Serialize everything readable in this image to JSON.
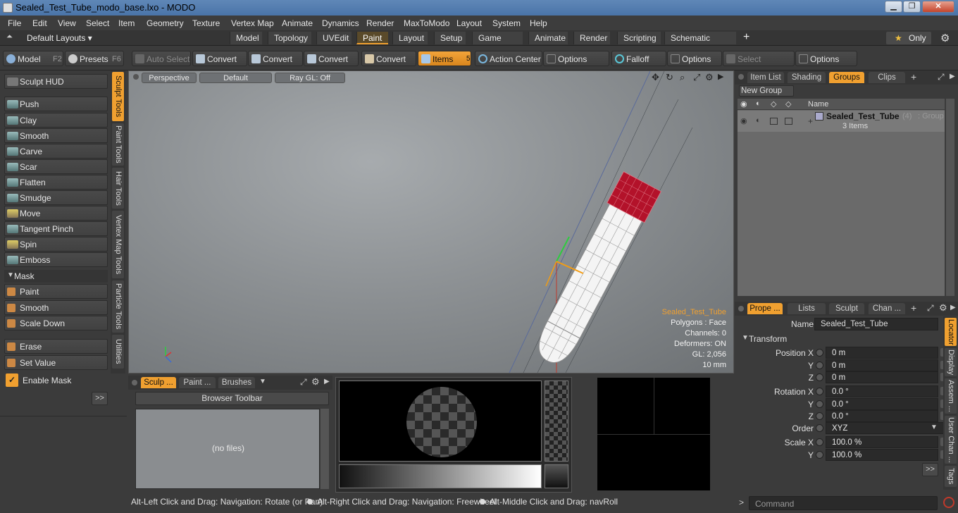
{
  "window": {
    "title": "Sealed_Test_Tube_modo_base.lxo - MODO",
    "controls": [
      "▁",
      "❐",
      "✕"
    ]
  },
  "menu": [
    "File",
    "Edit",
    "View",
    "Select",
    "Item",
    "Geometry",
    "Texture",
    "Vertex Map",
    "Animate",
    "Dynamics",
    "Render",
    "MaxToModo",
    "Layout",
    "System",
    "Help"
  ],
  "layouts": {
    "dropdown": "Default Layouts ▾",
    "tabs": [
      "Model",
      "Topology",
      "UVEdit",
      "Paint",
      "Layout",
      "Setup",
      "Game Tools",
      "Animate",
      "Render",
      "Scripting",
      "Schematic Fusion"
    ],
    "add": "+",
    "only": "Only",
    "star": "★"
  },
  "toolbar": {
    "model": "Model",
    "model_key": "F2",
    "presets": "Presets",
    "presets_key": "F6",
    "auto_select": "Auto Select",
    "convert": "Convert",
    "items": "Items",
    "items_key": "5",
    "action_center": "Action Center",
    "options": "Options",
    "falloff": "Falloff",
    "select_through": "Select Through"
  },
  "left": {
    "sculpt_hud": "Sculpt HUD",
    "tools": [
      "Push",
      "Clay",
      "Smooth",
      "Carve",
      "Scar",
      "Flatten",
      "Smudge",
      "Move",
      "Tangent Pinch",
      "Spin",
      "Emboss"
    ],
    "mask_header": "Mask",
    "mask_tools": [
      "Paint",
      "Smooth",
      "Scale Down"
    ],
    "erase": "Erase",
    "set_value": "Set Value",
    "enable_mask": "Enable Mask",
    "more": ">>"
  },
  "vtabs": [
    "Sculpt Tools",
    "Paint Tools",
    "Hair Tools",
    "Vertex Map Tools",
    "Particle Tools",
    "Utilities"
  ],
  "viewport": {
    "perspective": "Perspective",
    "default": "Default",
    "raygl": "Ray GL: Off",
    "info": {
      "name": "Sealed_Test_Tube",
      "polygons": "Polygons : Face",
      "channels": "Channels: 0",
      "deformers": "Deformers: ON",
      "gl": "GL: 2,056",
      "size": "10 mm"
    }
  },
  "right_top": {
    "tabs": [
      "Item List",
      "Shading",
      "Groups",
      "Clips"
    ],
    "new_group": "New Group",
    "name_col": "Name",
    "group_name": "Sealed_Test_Tube",
    "group_count": "(4)",
    "group_type": ": Group",
    "group_items": "3 Items"
  },
  "properties": {
    "tabs": [
      "Prope ...",
      "Lists",
      "Sculpt",
      "Chan ..."
    ],
    "name_label": "Name",
    "name_value": "Sealed_Test_Tube",
    "transform": "Transform",
    "rows": [
      {
        "label": "Position X",
        "value": "0 m"
      },
      {
        "label": "Y",
        "value": "0 m"
      },
      {
        "label": "Z",
        "value": "0 m"
      },
      {
        "label": "Rotation X",
        "value": "0.0 °"
      },
      {
        "label": "Y",
        "value": "0.0 °"
      },
      {
        "label": "Z",
        "value": "0.0 °"
      },
      {
        "label": "Order",
        "value": "XYZ"
      },
      {
        "label": "Scale X",
        "value": "100.0 %"
      },
      {
        "label": "Y",
        "value": "100.0 %"
      }
    ],
    "side_tabs": [
      "Locator",
      "Display",
      "Assem ...",
      "User Chan ...",
      "Tags"
    ],
    "more": ">>"
  },
  "bottom": {
    "tabs": [
      "Sculp ...",
      "Paint ...",
      "Brushes"
    ],
    "browser_toolbar": "Browser Toolbar",
    "no_files": "(no files)"
  },
  "status": {
    "hint1": "Alt-Left Click and Drag: Navigation: Rotate (or Pan)",
    "hint2": "Alt-Right Click and Drag: Navigation: Freewheel",
    "hint3": "Alt-Middle Click and Drag: navRoll"
  },
  "command": {
    "placeholder": "Command",
    "prompt": ">"
  },
  "colors": {
    "accent": "#f0a030",
    "cap": "#b3122a"
  }
}
